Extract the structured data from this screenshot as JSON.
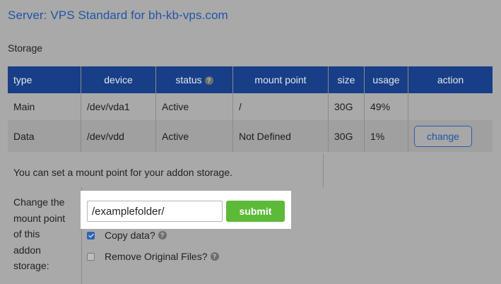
{
  "header": {
    "title": "Server: VPS Standard for bh-kb-vps.com"
  },
  "storage": {
    "section_label": "Storage",
    "columns": [
      "type",
      "device",
      "status",
      "mount point",
      "size",
      "usage",
      "action"
    ],
    "status_help_icon": "question-icon",
    "rows": [
      {
        "type": "Main",
        "device": "/dev/vda1",
        "status": "Active",
        "mount_point": "/",
        "size": "30G",
        "usage": "49%",
        "action": ""
      },
      {
        "type": "Data",
        "device": "/dev/vdd",
        "status": "Active",
        "mount_point": "Not Defined",
        "size": "30G",
        "usage": "1%",
        "action": "change"
      }
    ]
  },
  "mount_form": {
    "info_text": "You can set a mount point for your addon storage.",
    "label": "Change the mount point of this addon storage:",
    "input_value": "/examplefolder/",
    "submit_label": "submit",
    "submit_color": "#5cba38",
    "options": [
      {
        "label": "Copy data?",
        "checked": true,
        "icon": "question-icon"
      },
      {
        "label": "Remove Original Files?",
        "checked": false,
        "icon": "question-icon"
      }
    ]
  },
  "colors": {
    "header_bg": "#173e86",
    "title_blue": "#2155a6",
    "page_bg": "#a9a9a9"
  }
}
